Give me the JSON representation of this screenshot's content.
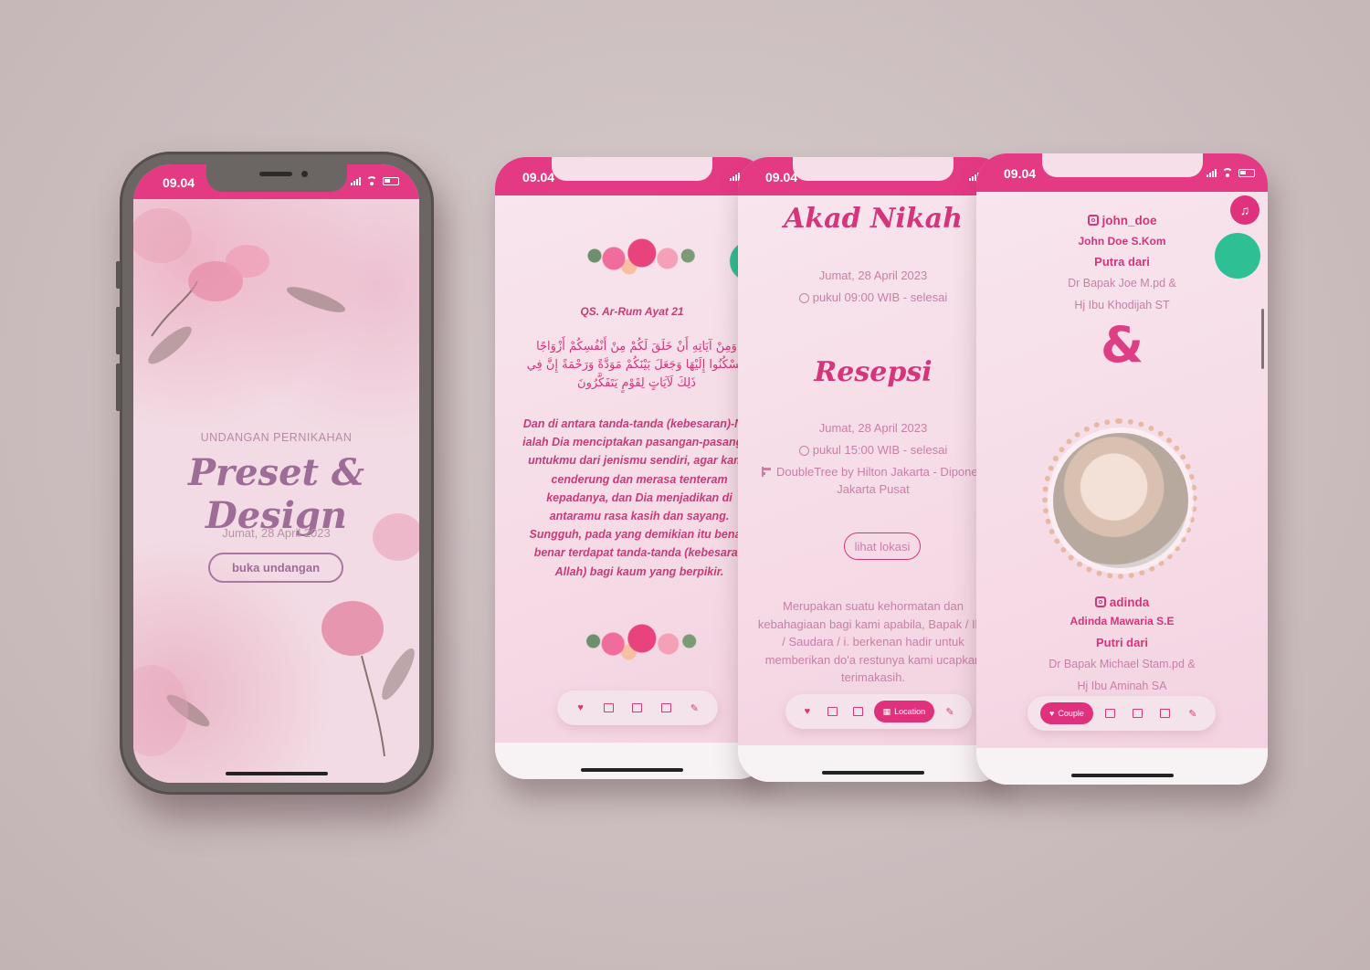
{
  "status": {
    "time": "09.04"
  },
  "cover": {
    "subtitle": "UNDANGAN PERNIKAHAN",
    "title": "Preset & Design",
    "date": "Jumat, 28 April 2023",
    "open_button": "buka undangan"
  },
  "quran": {
    "reference": "QS. Ar-Rum Ayat 21",
    "arabic": "وَمِنْ آيَاتِهِ أَنْ خَلَقَ لَكُمْ مِنْ أَنْفُسِكُمْ أَزْوَاجًا لِتَسْكُنُوا إِلَيْهَا وَجَعَلَ بَيْنَكُمْ مَوَدَّةً وَرَحْمَةً إِنَّ فِي ذَلِكَ لَآيَاتٍ لِقَوْمٍ يَتَفَكَّرُونَ",
    "translation": "Dan di antara tanda-tanda (kebesaran)-Nya ialah Dia menciptakan pasangan-pasangan untukmu dari jenismu sendiri, agar kamu cenderung dan merasa tenteram kepadanya, dan Dia menjadikan di antaramu rasa kasih dan sayang. Sungguh, pada yang demikian itu benar-benar terdapat tanda-tanda (kebesaran Allah) bagi kaum yang berpikir."
  },
  "event": {
    "akad_title": "Akad Nikah",
    "akad_date": "Jumat, 28 April 2023",
    "akad_time": "pukul 09:00 WIB - selesai",
    "resepsi_title": "Resepsi",
    "resepsi_date": "Jumat, 28 April 2023",
    "resepsi_time": "pukul 15:00 WIB - selesai",
    "venue_line1": "DoubleTree by Hilton Jakarta - Diponegoro",
    "venue_line2": "Jakarta Pusat",
    "location_button": "lihat lokasi",
    "closing": "Merupakan suatu kehormatan dan kebahagiaan bagi kami apabila, Bapak / Ibu / Saudara / i. berkenan hadir untuk memberikan do'a restunya kami ucapkan terimakasih."
  },
  "couple": {
    "groom_ig": "john_doe",
    "groom_name": "John Doe S.Kom",
    "groom_child_of": "Putra dari",
    "groom_father": "Dr Bapak Joe M.pd &",
    "groom_mother": "Hj Ibu Khodijah ST",
    "ampersand": "&",
    "bride_ig": "adinda",
    "bride_name": "Adinda Mawaria S.E",
    "bride_child_of": "Putri dari",
    "bride_father": "Dr Bapak Michael Stam.pd &",
    "bride_mother": "Hj Ibu Aminah SA"
  },
  "nav": {
    "location_label": "Location",
    "couple_label": "Couple"
  },
  "colors": {
    "accent": "#e43983",
    "text_pink": "#d4357b",
    "muted_pink": "#c87fa6",
    "fab_green": "#2ebf94"
  },
  "icons": [
    "heart-icon",
    "gallery-icon",
    "calendar-icon",
    "map-icon",
    "edit-icon",
    "music-icon",
    "gift-icon",
    "instagram-icon",
    "clock-icon",
    "signpost-icon"
  ]
}
